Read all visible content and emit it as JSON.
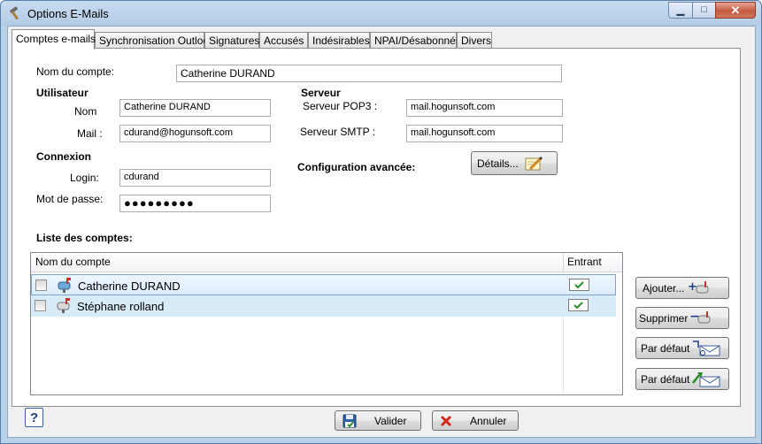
{
  "window": {
    "title": "Options E-Mails",
    "controls": {
      "minimize": "▁",
      "maximize": "□",
      "close": "✕"
    }
  },
  "tabs": [
    {
      "label": "Comptes e-mails",
      "active": true
    },
    {
      "label": "Synchronisation Outlook"
    },
    {
      "label": "Signatures"
    },
    {
      "label": "Accusés"
    },
    {
      "label": "Indésirables"
    },
    {
      "label": "NPAI/Désabonnés"
    },
    {
      "label": "Divers"
    }
  ],
  "account": {
    "name_label": "Nom du compte:",
    "name_value": "Catherine DURAND"
  },
  "user": {
    "heading": "Utilisateur",
    "nom_label": "Nom",
    "nom_value": "Catherine DURAND",
    "mail_label": "Mail :",
    "mail_value": "cdurand@hogunsoft.com"
  },
  "server": {
    "heading": "Serveur",
    "pop3_label": "Serveur POP3 :",
    "pop3_value": "mail.hogunsoft.com",
    "smtp_label": "Serveur SMTP :",
    "smtp_value": "mail.hogunsoft.com"
  },
  "connection": {
    "heading": "Connexion",
    "login_label": "Login:",
    "login_value": "cdurand",
    "password_label": "Mot de passe:",
    "password_value": "●●●●●●●●●"
  },
  "advanced": {
    "label": "Configuration avancée:",
    "details_button": "Détails..."
  },
  "accounts_list": {
    "heading": "Liste des comptes:",
    "columns": [
      "Nom du compte",
      "Entrant"
    ],
    "rows": [
      {
        "name": "Catherine DURAND",
        "checked": false,
        "entrant": true,
        "selected": true
      },
      {
        "name": "Stéphane rolland",
        "checked": false,
        "entrant": true,
        "selected": false
      }
    ]
  },
  "side_buttons": {
    "add": "Ajouter...",
    "remove": "Supprimer",
    "default_in": "Par défaut",
    "default_out": "Par défaut"
  },
  "footer": {
    "help": "?",
    "validate": "Valider",
    "cancel": "Annuler"
  },
  "colors": {
    "title_bar": "#b9d1ea",
    "close_button": "#c45a40",
    "selected_row": "#dcecfc",
    "alt_row": "#d7ebf8",
    "check_green": "#2c8c2c"
  }
}
